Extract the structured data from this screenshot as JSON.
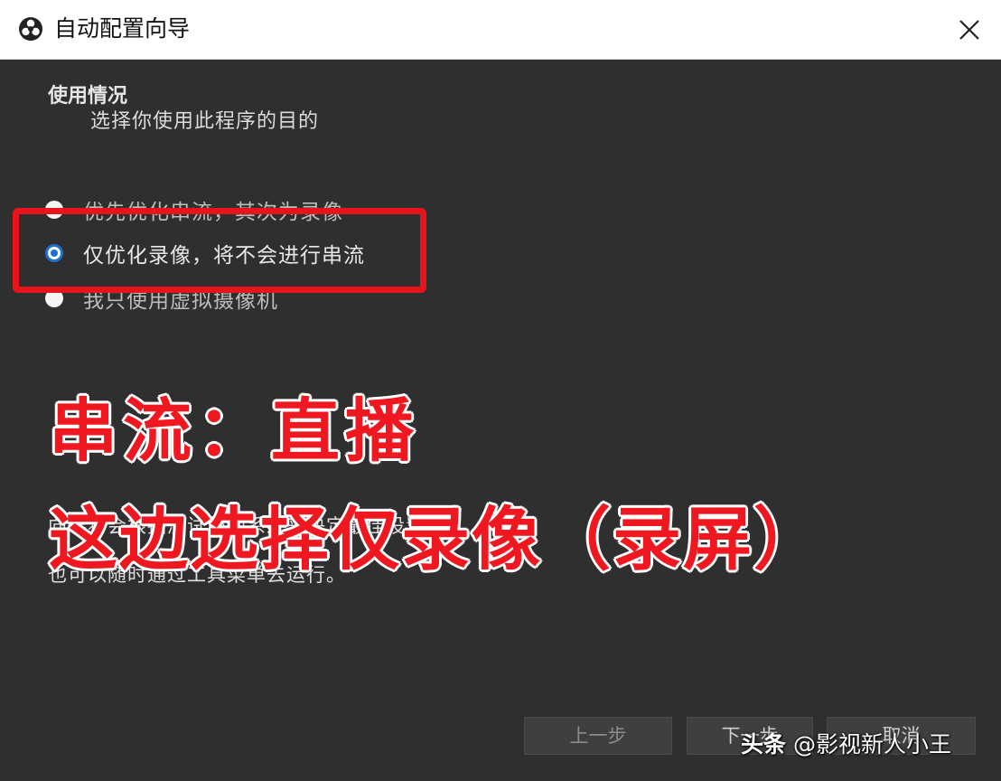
{
  "window": {
    "title": "自动配置向导",
    "app_icon": "obs-logo-icon",
    "close_icon": "close-icon"
  },
  "usage": {
    "heading": "使用情况",
    "subheading": "选择你使用此程序的目的",
    "options": [
      {
        "label": "优先优化串流，其次为录像",
        "checked": false
      },
      {
        "label": "仅优化录像，将不会进行串流",
        "checked": true
      },
      {
        "label": "我只使用虚拟摄像机",
        "checked": false
      }
    ]
  },
  "info": {
    "line1": "向导将会根据测试您的系统来决定最佳设置。",
    "line2": "也可以随时通过工具菜单去运行。"
  },
  "overlay": {
    "line1": "串流：直播",
    "line2": "这边选择仅录像（录屏）"
  },
  "buttons": {
    "back": "上一步",
    "next": "下一步",
    "cancel": "取消"
  },
  "watermark": {
    "brand": "头条",
    "handle": "@影视新人小王"
  },
  "colors": {
    "highlight": "#e8141c",
    "radio_accent": "#1e6fd1",
    "background": "#2f2f2f"
  }
}
